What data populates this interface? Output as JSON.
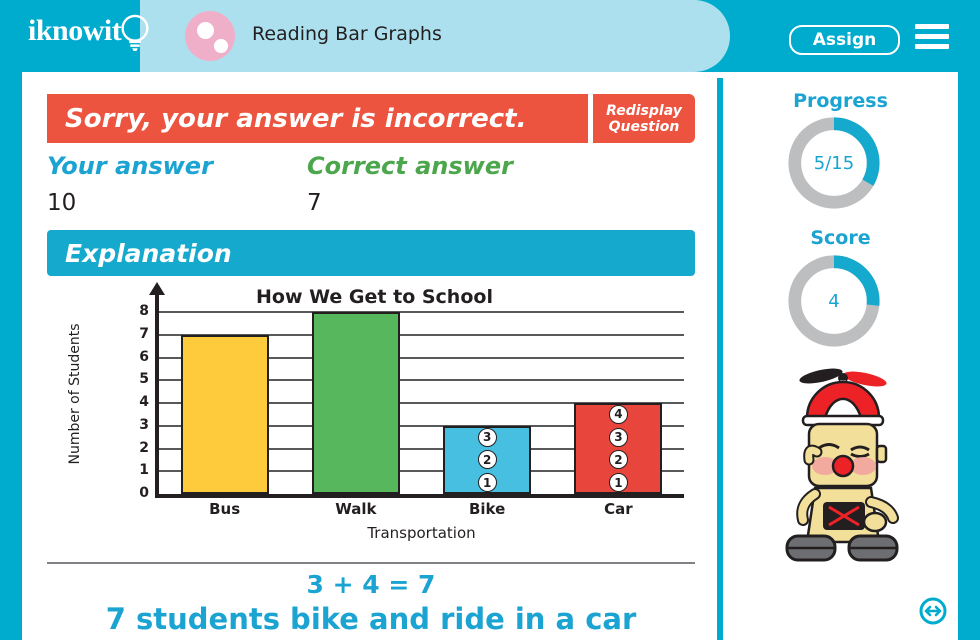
{
  "header": {
    "logo_text": "iknowit",
    "logo_icon": "lightbulb-icon",
    "lesson_title": "Reading Bar Graphs",
    "title_icon": "dots-circle-icon",
    "assign_label": "Assign",
    "menu_icon": "hamburger-menu-icon",
    "bar_color": "#00ACCE",
    "pill_color": "#ACE0EE",
    "circle_color": "#EFAFC9"
  },
  "feedback": {
    "message": "Sorry, your answer is incorrect.",
    "banner_color": "#EC5440",
    "redisplay_line1": "Redisplay",
    "redisplay_line2": "Question",
    "your_answer_label": "Your answer",
    "your_answer_value": "10",
    "your_answer_color": "#1BA3D1",
    "correct_answer_label": "Correct answer",
    "correct_answer_value": "7",
    "correct_answer_color": "#4CA64C"
  },
  "explanation": {
    "heading": "Explanation",
    "heading_color": "#16A9CE",
    "equation": "3 + 4 = 7",
    "sentence": "7 students bike and ride in a car",
    "text_color": "#1BA3D1"
  },
  "chart_data": {
    "type": "bar",
    "title": "How We Get to School",
    "xlabel": "Transportation",
    "ylabel": "Number of Students",
    "categories": [
      "Bus",
      "Walk",
      "Bike",
      "Car"
    ],
    "values": [
      7,
      8,
      3,
      4
    ],
    "colors": [
      "#FDCB3C",
      "#57B75C",
      "#47BFE0",
      "#E8463C"
    ],
    "counters": [
      [],
      [],
      [
        "1",
        "2",
        "3"
      ],
      [
        "1",
        "2",
        "3",
        "4"
      ]
    ],
    "ylim": [
      0,
      8
    ],
    "yticks": [
      "0",
      "1",
      "2",
      "3",
      "4",
      "5",
      "6",
      "7",
      "8"
    ],
    "grid": true,
    "legend": "none"
  },
  "sidebar": {
    "progress_label": "Progress",
    "progress_value": "5/15",
    "progress_fraction": 0.3333,
    "score_label": "Score",
    "score_value": "4",
    "score_fraction": 0.2667,
    "donut_fill_color": "#16A9CE",
    "donut_track_color": "#BCBEC0",
    "mascot_icon": "robot-mascot-icon",
    "resize_icon": "resize-horizontal-icon"
  }
}
